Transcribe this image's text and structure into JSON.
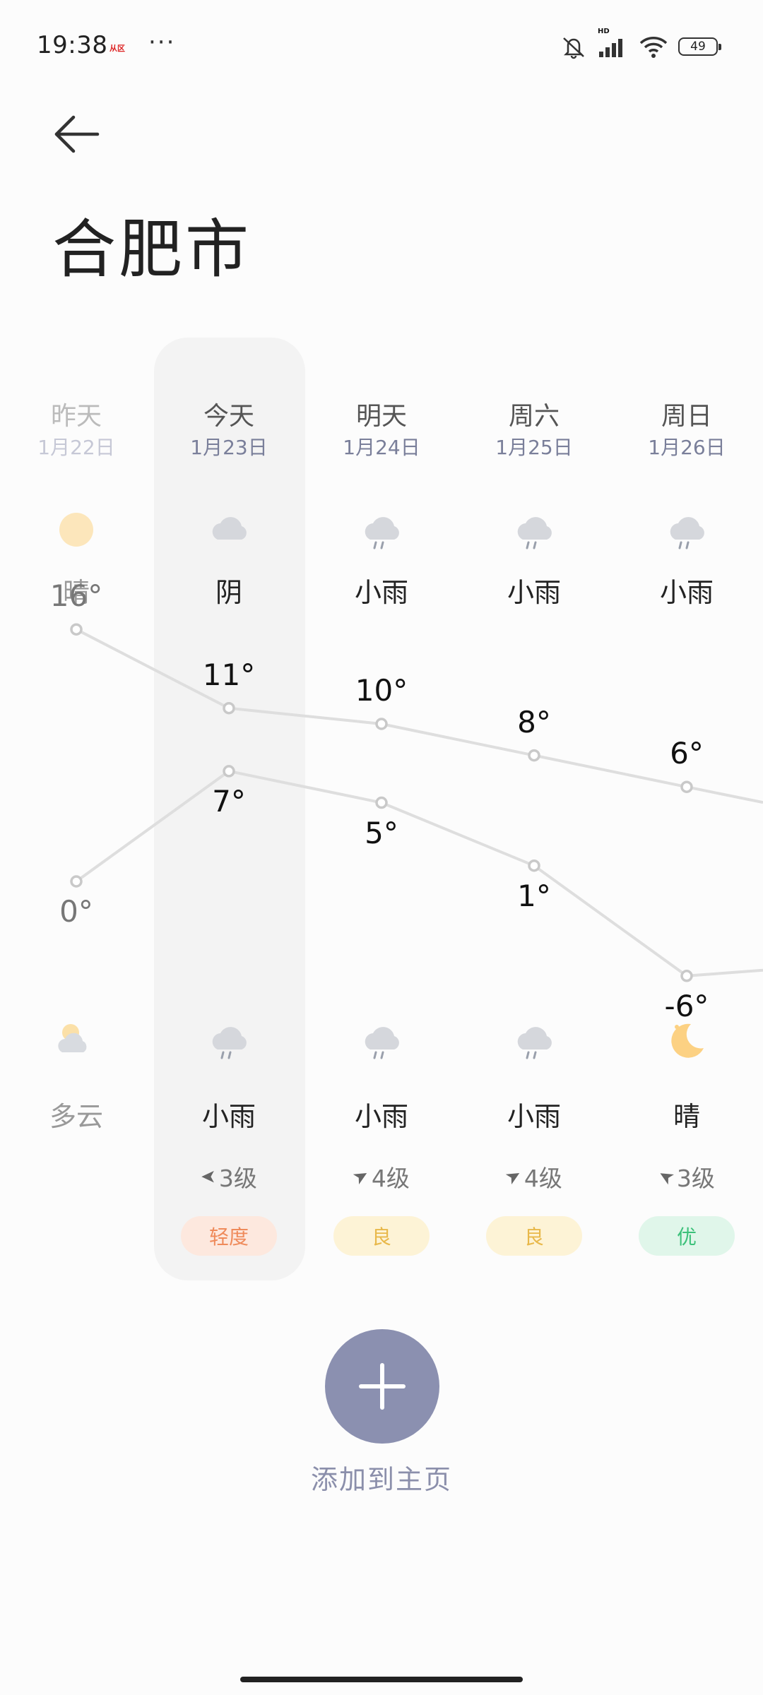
{
  "status_bar": {
    "time": "19:38",
    "carrier_badge": "从区",
    "more": "···",
    "battery": "49",
    "hd_label": "HD"
  },
  "header": {
    "back_icon": "arrow-left-icon",
    "city": "合肥市"
  },
  "days": [
    {
      "label": "昨天",
      "date": "1月22日",
      "day_cond": "晴",
      "day_icon": "sun-icon",
      "high": "16°",
      "low": "0°",
      "night_cond": "多云",
      "night_icon": "partly-cloudy-night-icon",
      "wind": "",
      "aqi": ""
    },
    {
      "label": "今天",
      "date": "1月23日",
      "day_cond": "阴",
      "day_icon": "cloud-icon",
      "high": "11°",
      "low": "7°",
      "night_cond": "小雨",
      "night_icon": "light-rain-icon",
      "wind": "3级",
      "aqi": "轻度"
    },
    {
      "label": "明天",
      "date": "1月24日",
      "day_cond": "小雨",
      "day_icon": "light-rain-icon",
      "high": "10°",
      "low": "5°",
      "night_cond": "小雨",
      "night_icon": "light-rain-icon",
      "wind": "4级",
      "aqi": "良"
    },
    {
      "label": "周六",
      "date": "1月25日",
      "day_cond": "小雨",
      "day_icon": "light-rain-icon",
      "high": "8°",
      "low": "1°",
      "night_cond": "小雨",
      "night_icon": "light-rain-icon",
      "wind": "4级",
      "aqi": "良"
    },
    {
      "label": "周日",
      "date": "1月26日",
      "day_cond": "小雨",
      "day_icon": "light-rain-icon",
      "high": "6°",
      "low": "-6°",
      "night_cond": "晴",
      "night_icon": "moon-icon",
      "wind": "3级",
      "aqi": "优"
    }
  ],
  "temps": {
    "high_values": [
      16,
      11,
      10,
      8,
      6
    ],
    "low_values": [
      0,
      7,
      5,
      1,
      -6
    ]
  },
  "colors": {
    "aqi_light_bg": "#fde8de",
    "aqi_light_fg": "#ef8a5a",
    "aqi_good_bg": "#fdf3d6",
    "aqi_good_fg": "#e8b84a",
    "aqi_excellent_bg": "#e0f6ea",
    "aqi_excellent_fg": "#3cc17a",
    "accent": "#8b90b0"
  },
  "add_to_home": {
    "icon": "plus-icon",
    "label": "添加到主页"
  }
}
